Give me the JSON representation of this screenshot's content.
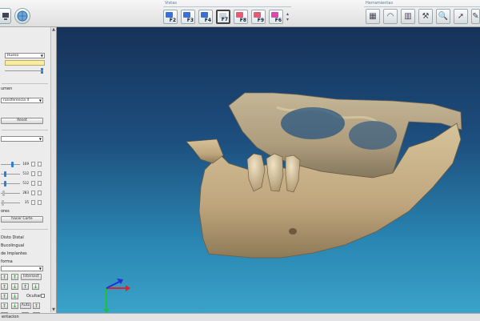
{
  "toolbar": {
    "vistas_label": "Vistas",
    "herramientas_label": "Herramientas",
    "view_buttons": [
      {
        "key": "F2",
        "color": "#3a6fd8"
      },
      {
        "key": "F3",
        "color": "#3a6fd8"
      },
      {
        "key": "F4",
        "color": "#3a6fd8"
      },
      {
        "key": "F7",
        "color": "#cfd6da",
        "active": true
      },
      {
        "key": "F8",
        "color": "#e65a73"
      },
      {
        "key": "F9",
        "color": "#e65a73"
      },
      {
        "key": "F6",
        "color": "#d84ab0"
      }
    ],
    "tool_icons": [
      "layout-icon",
      "rainbow-icon",
      "sections-icon",
      "wrench-icon",
      "magnifier-icon",
      "pointer-icon",
      "pen-icon"
    ]
  },
  "left_panel": {
    "combo_hueso": "Hueso",
    "header_volumen": "umen",
    "combo_transferencia": "ransferencia 4",
    "reset_label": "Reset",
    "sliders": [
      {
        "value": "169",
        "fraction": 0.6
      },
      {
        "value": "512",
        "fraction": 0.2
      },
      {
        "value": "512",
        "fraction": 0.2
      },
      {
        "value": "283",
        "fraction": 0.1
      },
      {
        "value": "35",
        "fraction": 0.05
      }
    ],
    "ores_label": "ores",
    "hacer_corte": "hacer Corte",
    "radio_options": [
      "Disto Distal",
      "Bucolingual",
      "de Implantes"
    ],
    "forma_label": "forma",
    "intersect_label": "Intersect",
    "ocultar_label": "Ocultar",
    "auto_label": "Auto"
  },
  "status": {
    "text": "entacion"
  },
  "colors": {
    "viewport_top": "#16325a",
    "viewport_bottom": "#3aa3c9",
    "bone": "#c9b28a",
    "accent_blue": "#2f7fd0"
  }
}
